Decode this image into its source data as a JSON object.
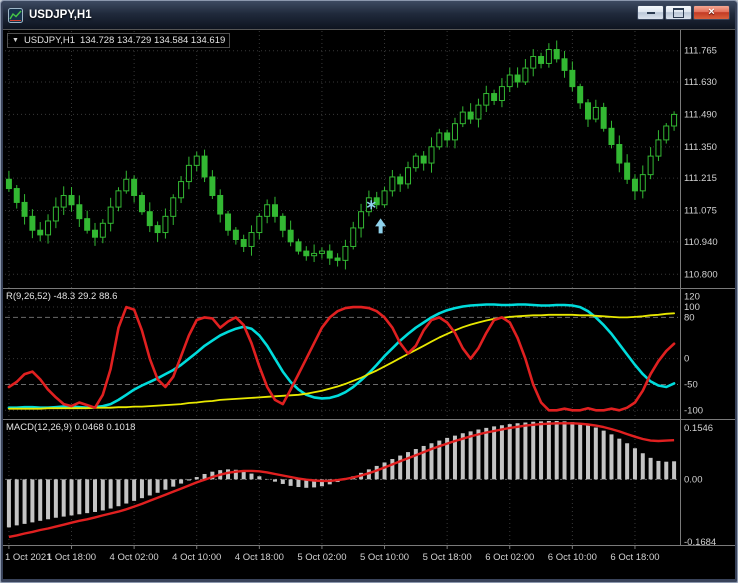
{
  "window": {
    "title": "USDJPY,H1",
    "close_glyph": "×"
  },
  "panes": {
    "toggle_glyph": "▼",
    "main_symbol": "USDJPY,H1",
    "main_ohlc": "134.728 134.729 134.584 134.619",
    "oscillator_label": "R(9,26,52) -48.3 29.2 88.6",
    "macd_label": "MACD(12,26,9) 0.0468 0.1018"
  },
  "colors": {
    "background": "#000000",
    "grid": "#383838",
    "candle": "#33B833",
    "separator": "#7a7a7a",
    "level": "#6a6a6a",
    "scale_text": "#d2d2d2"
  },
  "x_axis": {
    "labels": [
      {
        "bar": 0,
        "t": "1 Oct 2021"
      },
      {
        "bar": 8,
        "t": "1 Oct 18:00"
      },
      {
        "bar": 16,
        "t": "4 Oct 02:00"
      },
      {
        "bar": 24,
        "t": "4 Oct 10:00"
      },
      {
        "bar": 32,
        "t": "4 Oct 18:00"
      },
      {
        "bar": 40,
        "t": "5 Oct 02:00"
      },
      {
        "bar": 48,
        "t": "5 Oct 10:00"
      },
      {
        "bar": 56,
        "t": "5 Oct 18:00"
      },
      {
        "bar": 64,
        "t": "6 Oct 02:00"
      },
      {
        "bar": 72,
        "t": "6 Oct 10:00"
      },
      {
        "bar": 80,
        "t": "6 Oct 18:00"
      }
    ]
  },
  "chart_data": [
    {
      "type": "candlestick",
      "title": "USDJPY H1",
      "ylim": [
        110.745,
        111.85
      ],
      "closes": [
        111.17,
        111.11,
        111.05,
        110.99,
        110.97,
        111.03,
        111.09,
        111.14,
        111.1,
        111.04,
        110.99,
        110.96,
        111.02,
        111.09,
        111.16,
        111.21,
        111.14,
        111.07,
        111.01,
        110.98,
        111.05,
        111.13,
        111.2,
        111.27,
        111.31,
        111.22,
        111.14,
        111.06,
        110.99,
        110.95,
        110.92,
        110.98,
        111.05,
        111.1,
        111.05,
        110.99,
        110.94,
        110.9,
        110.88,
        110.89,
        110.9,
        110.87,
        110.86,
        110.92,
        111.0,
        111.07,
        111.13,
        111.1,
        111.16,
        111.22,
        111.19,
        111.26,
        111.31,
        111.28,
        111.35,
        111.41,
        111.38,
        111.45,
        111.5,
        111.47,
        111.53,
        111.58,
        111.55,
        111.61,
        111.66,
        111.63,
        111.69,
        111.74,
        111.71,
        111.77,
        111.73,
        111.68,
        111.61,
        111.54,
        111.47,
        111.52,
        111.43,
        111.36,
        111.28,
        111.21,
        111.16,
        111.23,
        111.31,
        111.38,
        111.44,
        111.49
      ],
      "y_axis_labels": [
        {
          "v": 111.765,
          "t": "111.765"
        },
        {
          "v": 111.63,
          "t": "111.630"
        },
        {
          "v": 111.49,
          "t": "111.490"
        },
        {
          "v": 111.35,
          "t": "111.350"
        },
        {
          "v": 111.215,
          "t": "111.215"
        },
        {
          "v": 111.075,
          "t": "111.075"
        },
        {
          "v": 110.94,
          "t": "110.940"
        },
        {
          "v": 110.8,
          "t": "110.800"
        }
      ],
      "annotations": [
        {
          "type": "up-arrow",
          "bar": 47.5,
          "price": 110.985,
          "color": "#8FD2EC"
        },
        {
          "type": "star",
          "bar": 46.3,
          "price": 111.1,
          "color": "#8FD2EC"
        }
      ]
    },
    {
      "type": "line",
      "name": "R(9,26,52)",
      "ylim": [
        -115,
        135
      ],
      "levels": [
        80,
        -50
      ],
      "y_axis_labels": [
        {
          "v": 120,
          "t": "120"
        },
        {
          "v": 100,
          "t": "100"
        },
        {
          "v": 80,
          "t": "80"
        },
        {
          "v": 0,
          "t": "0"
        },
        {
          "v": -50,
          "t": "-50"
        },
        {
          "v": -100,
          "t": "-100"
        }
      ],
      "series": [
        {
          "name": "fast",
          "color": "#E02020",
          "values": [
            -55,
            -45,
            -30,
            -25,
            -40,
            -60,
            -75,
            -88,
            -92,
            -85,
            -90,
            -95,
            -70,
            -20,
            60,
            100,
            95,
            55,
            0,
            -40,
            -55,
            -35,
            5,
            45,
            75,
            80,
            78,
            60,
            72,
            80,
            65,
            30,
            -15,
            -55,
            -80,
            -88,
            -60,
            -30,
            0,
            30,
            60,
            80,
            92,
            98,
            100,
            100,
            98,
            92,
            80,
            60,
            30,
            10,
            25,
            55,
            75,
            80,
            70,
            50,
            20,
            0,
            20,
            50,
            75,
            80,
            70,
            40,
            0,
            -50,
            -85,
            -100,
            -100,
            -97,
            -100,
            -100,
            -96,
            -100,
            -100,
            -97,
            -100,
            -95,
            -85,
            -62,
            -30,
            -5,
            15,
            29
          ]
        },
        {
          "name": "medium",
          "color": "#00DCDC",
          "values": [
            -95,
            -95,
            -94,
            -94,
            -95,
            -95,
            -94,
            -93,
            -93,
            -94,
            -95,
            -94,
            -92,
            -88,
            -80,
            -70,
            -60,
            -52,
            -45,
            -38,
            -30,
            -22,
            -12,
            0,
            12,
            25,
            35,
            45,
            52,
            58,
            62,
            58,
            45,
            25,
            0,
            -25,
            -45,
            -60,
            -70,
            -75,
            -77,
            -76,
            -72,
            -65,
            -55,
            -42,
            -28,
            -12,
            5,
            20,
            35,
            48,
            60,
            70,
            80,
            88,
            94,
            98,
            101,
            103,
            104,
            105,
            105,
            104,
            104,
            105,
            105,
            104,
            103,
            103,
            104,
            104,
            103,
            100,
            92,
            80,
            65,
            48,
            28,
            8,
            -12,
            -30,
            -44,
            -52,
            -55,
            -48
          ]
        },
        {
          "name": "slow",
          "color": "#E8E800",
          "values": [
            -97,
            -97,
            -97,
            -97,
            -97,
            -96,
            -96,
            -96,
            -96,
            -96,
            -96,
            -95,
            -95,
            -95,
            -94,
            -94,
            -93,
            -93,
            -92,
            -91,
            -90,
            -89,
            -88,
            -86,
            -85,
            -83,
            -82,
            -80,
            -79,
            -78,
            -77,
            -76,
            -75,
            -74,
            -73,
            -72,
            -71,
            -70,
            -68,
            -65,
            -62,
            -58,
            -54,
            -49,
            -43,
            -37,
            -30,
            -23,
            -15,
            -7,
            1,
            9,
            17,
            25,
            33,
            41,
            48,
            55,
            61,
            66,
            70,
            74,
            77,
            79,
            81,
            82,
            83,
            84,
            84,
            85,
            85,
            85,
            85,
            84,
            84,
            83,
            82,
            81,
            80,
            80,
            81,
            82,
            84,
            85,
            87,
            88
          ]
        }
      ]
    },
    {
      "type": "macd",
      "name": "MACD(12,26,9)",
      "values_display": [
        "0.0468",
        "0.1018"
      ],
      "ylim": [
        -0.1684,
        0.1546
      ],
      "histogram_color": "#C4C4C4",
      "signal_color": "#E02020",
      "histogram": [
        -0.125,
        -0.12,
        -0.116,
        -0.112,
        -0.108,
        -0.104,
        -0.1,
        -0.097,
        -0.094,
        -0.091,
        -0.088,
        -0.085,
        -0.081,
        -0.076,
        -0.07,
        -0.063,
        -0.056,
        -0.049,
        -0.042,
        -0.035,
        -0.027,
        -0.019,
        -0.011,
        -0.003,
        0.006,
        0.014,
        0.02,
        0.024,
        0.026,
        0.025,
        0.021,
        0.015,
        0.008,
        0.001,
        -0.006,
        -0.012,
        -0.017,
        -0.02,
        -0.022,
        -0.021,
        -0.018,
        -0.013,
        -0.007,
        0.0,
        0.008,
        0.017,
        0.026,
        0.035,
        0.044,
        0.053,
        0.062,
        0.071,
        0.079,
        0.087,
        0.094,
        0.101,
        0.108,
        0.114,
        0.12,
        0.125,
        0.13,
        0.134,
        0.138,
        0.141,
        0.144,
        0.146,
        0.148,
        0.15,
        0.151,
        0.152,
        0.152,
        0.151,
        0.149,
        0.146,
        0.141,
        0.135,
        0.127,
        0.117,
        0.106,
        0.094,
        0.081,
        0.068,
        0.056,
        0.048,
        0.046,
        0.047
      ],
      "signal": [
        -0.15,
        -0.146,
        -0.141,
        -0.137,
        -0.132,
        -0.128,
        -0.123,
        -0.118,
        -0.113,
        -0.108,
        -0.104,
        -0.099,
        -0.094,
        -0.089,
        -0.084,
        -0.078,
        -0.071,
        -0.064,
        -0.056,
        -0.048,
        -0.04,
        -0.032,
        -0.024,
        -0.016,
        -0.008,
        -0.001,
        0.006,
        0.012,
        0.017,
        0.02,
        0.022,
        0.022,
        0.021,
        0.018,
        0.014,
        0.01,
        0.006,
        0.002,
        -0.001,
        -0.003,
        -0.004,
        -0.004,
        -0.002,
        0.001,
        0.005,
        0.01,
        0.016,
        0.023,
        0.031,
        0.039,
        0.047,
        0.055,
        0.063,
        0.071,
        0.079,
        0.086,
        0.093,
        0.1,
        0.106,
        0.112,
        0.117,
        0.122,
        0.126,
        0.13,
        0.134,
        0.137,
        0.14,
        0.142,
        0.144,
        0.145,
        0.146,
        0.146,
        0.146,
        0.145,
        0.143,
        0.14,
        0.136,
        0.131,
        0.125,
        0.118,
        0.111,
        0.105,
        0.101,
        0.1,
        0.101,
        0.102
      ],
      "y_axis_labels": [
        {
          "v": 0.1546,
          "t": "0.1546"
        },
        {
          "v": 0,
          "t": "0.00"
        },
        {
          "v": -0.1684,
          "t": "-0.1684"
        }
      ]
    }
  ]
}
